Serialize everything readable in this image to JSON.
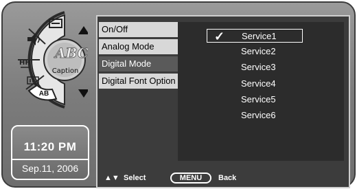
{
  "wheel": {
    "caption_label": "Caption",
    "ab_label": "AB"
  },
  "clock": {
    "time": "11:20 PM",
    "date": "Sep.11, 2006"
  },
  "menu": {
    "items": [
      {
        "label": "On/Off"
      },
      {
        "label": "Analog Mode"
      },
      {
        "label": "Digital Mode"
      },
      {
        "label": "Digital Font Option"
      }
    ]
  },
  "dropdown": {
    "options": [
      {
        "label": "Service1",
        "selected": true
      },
      {
        "label": "Service2"
      },
      {
        "label": "Service3"
      },
      {
        "label": "Service4"
      },
      {
        "label": "Service5"
      },
      {
        "label": "Service6"
      }
    ],
    "check_mark": "✓"
  },
  "footer": {
    "arrows": "▲▼",
    "select_label": "Select",
    "menu_button": "MENU",
    "back_label": "Back"
  },
  "colors": {
    "panel": "#3c3c3c",
    "menu_item_bg": "#d8d8d8",
    "frame": "#8a8a8a"
  }
}
